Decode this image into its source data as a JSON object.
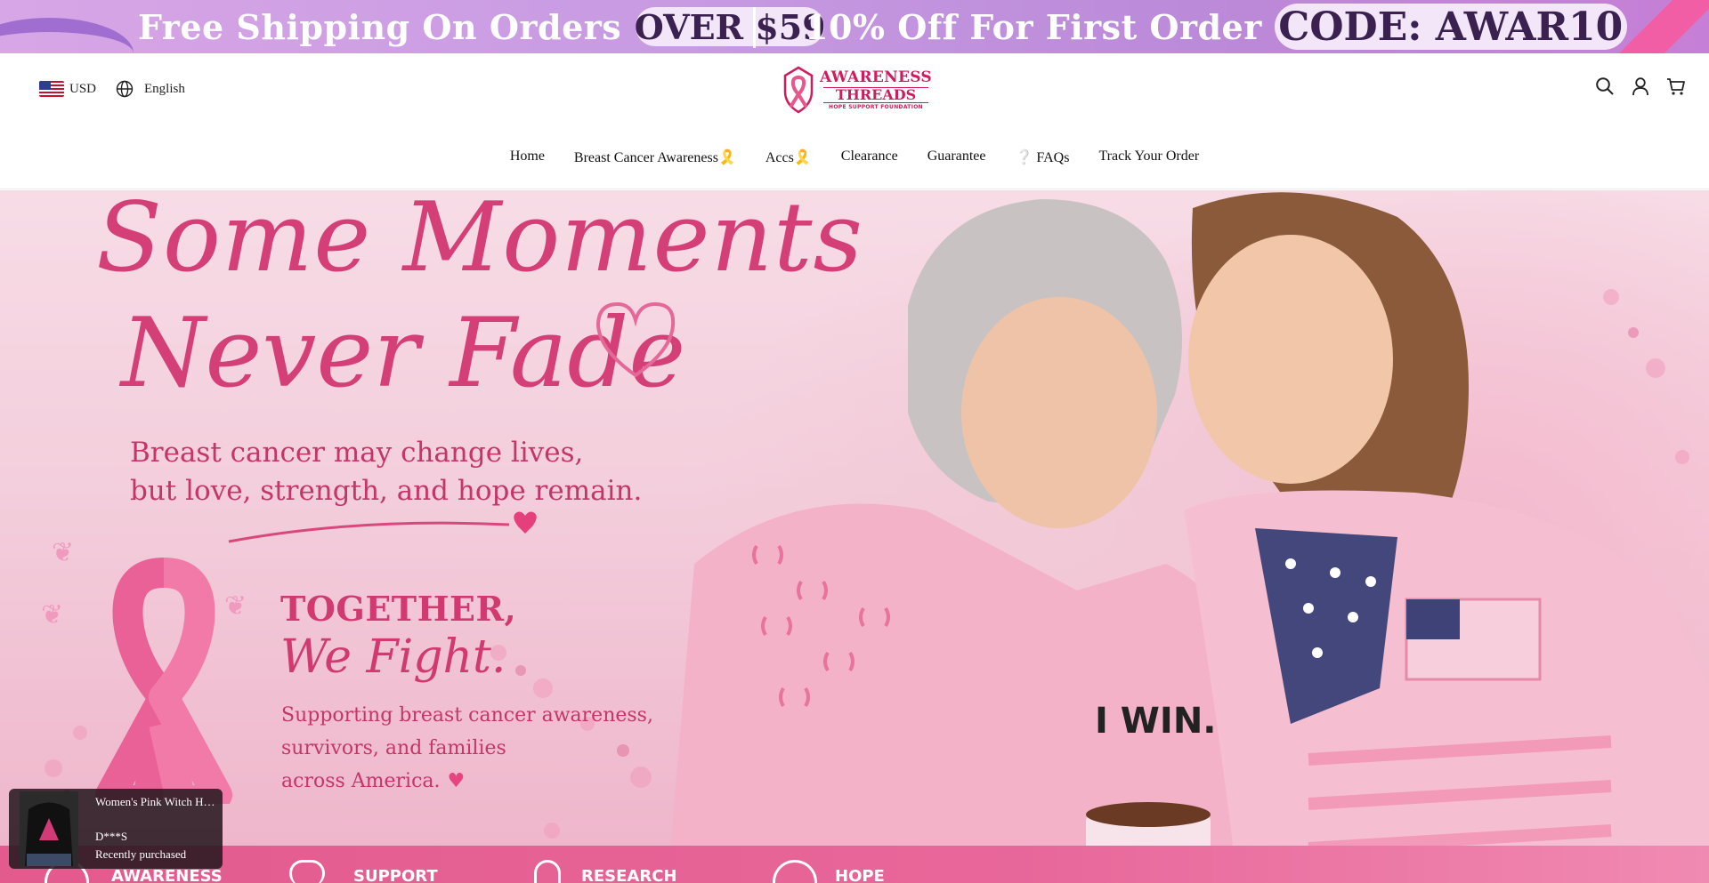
{
  "announcement": {
    "shipping_text": "Free Shipping On Orders",
    "shipping_pill": "OVER $59",
    "discount_text": "10% Off For First Order",
    "discount_pill": "CODE: AWAR10"
  },
  "header": {
    "currency": "USD",
    "language": "English",
    "logo": {
      "line1": "AWARENESS",
      "line2": "THREADS",
      "line3": "HOPE SUPPORT FOUNDATION"
    },
    "icons": [
      "search-icon",
      "account-icon",
      "cart-icon"
    ]
  },
  "nav": {
    "items": [
      {
        "label": "Home"
      },
      {
        "label": "Breast Cancer Awareness🎗️"
      },
      {
        "label": "Accs🎗️"
      },
      {
        "label": "Clearance"
      },
      {
        "label": " Guarantee"
      },
      {
        "label": "❔ FAQs"
      },
      {
        "label": "Track Your Order"
      }
    ]
  },
  "hero": {
    "headline_line1": "Some Moments",
    "headline_line2": "Never Fade",
    "subline_line1": "Breast cancer may change lives,",
    "subline_line2": "but love, strength, and hope remain.",
    "together_line1": "TOGETHER,",
    "together_line2": "We Fight.",
    "support_line1": "Supporting breast cancer awareness,",
    "support_line2": "survivors, and families",
    "support_line3": "across America.",
    "shirt_text": "I WIN.",
    "strip_items": [
      "AWARENESS",
      "SUPPORT",
      "RESEARCH",
      "HOPE"
    ],
    "colors": {
      "accent": "#d43f77",
      "strip": "#e35a8d"
    }
  },
  "toast": {
    "title": "Women's Pink Witch Hat Halloween Sweatshirt",
    "user": "D***S",
    "status": "Recently purchased"
  }
}
